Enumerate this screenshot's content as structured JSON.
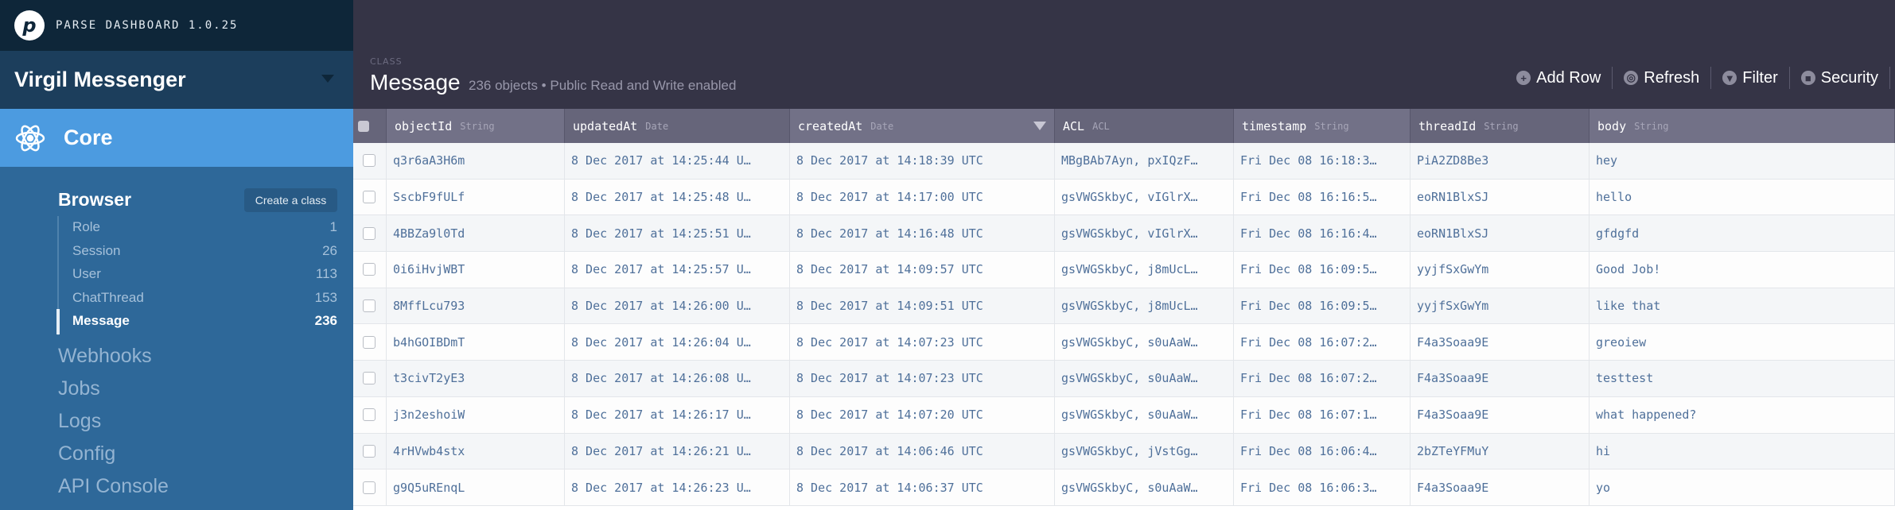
{
  "brand": {
    "title": "PARSE DASHBOARD 1.0.25"
  },
  "app": {
    "name": "Virgil Messenger"
  },
  "sidebar": {
    "section": "Core",
    "browser": {
      "label": "Browser",
      "create_label": "Create a class",
      "classes": [
        {
          "name": "Role",
          "count": "1"
        },
        {
          "name": "Session",
          "count": "26"
        },
        {
          "name": "User",
          "count": "113"
        },
        {
          "name": "ChatThread",
          "count": "153"
        },
        {
          "name": "Message",
          "count": "236",
          "active": true
        }
      ]
    },
    "nav": [
      "Webhooks",
      "Jobs",
      "Logs",
      "Config",
      "API Console"
    ]
  },
  "header": {
    "class_label": "CLASS",
    "class_name": "Message",
    "subtitle": "236 objects • Public Read and Write enabled",
    "toolbar": [
      {
        "label": "Add Row",
        "icon": "plus-circle-icon"
      },
      {
        "label": "Refresh",
        "icon": "refresh-icon"
      },
      {
        "label": "Filter",
        "icon": "filter-icon"
      },
      {
        "label": "Security",
        "icon": "lock-icon"
      }
    ]
  },
  "table": {
    "sorted_column": "createdAt",
    "sort_direction": "descending",
    "columns": [
      {
        "name": "objectId",
        "type": "String"
      },
      {
        "name": "updatedAt",
        "type": "Date"
      },
      {
        "name": "createdAt",
        "type": "Date"
      },
      {
        "name": "ACL",
        "type": "ACL"
      },
      {
        "name": "timestamp",
        "type": "String"
      },
      {
        "name": "threadId",
        "type": "String"
      },
      {
        "name": "body",
        "type": "String"
      }
    ],
    "rows": [
      [
        "q3r6aA3H6m",
        "8 Dec 2017 at 14:25:44 U…",
        "8 Dec 2017 at 14:18:39 UTC",
        "MBgBAb7Ayn, pxIQzF…",
        "Fri Dec 08 16:18:3…",
        "PiA2ZD8Be3",
        "hey"
      ],
      [
        "SscbF9fULf",
        "8 Dec 2017 at 14:25:48 U…",
        "8 Dec 2017 at 14:17:00 UTC",
        "gsVWGSkbyC, vIGlrX…",
        "Fri Dec 08 16:16:5…",
        "eoRN1BlxSJ",
        "hello"
      ],
      [
        "4BBZa9l0Td",
        "8 Dec 2017 at 14:25:51 U…",
        "8 Dec 2017 at 14:16:48 UTC",
        "gsVWGSkbyC, vIGlrX…",
        "Fri Dec 08 16:16:4…",
        "eoRN1BlxSJ",
        "gfdgfd"
      ],
      [
        "0i6iHvjWBT",
        "8 Dec 2017 at 14:25:57 U…",
        "8 Dec 2017 at 14:09:57 UTC",
        "gsVWGSkbyC, j8mUcL…",
        "Fri Dec 08 16:09:5…",
        "yyjfSxGwYm",
        "Good Job!"
      ],
      [
        "8MffLcu793",
        "8 Dec 2017 at 14:26:00 U…",
        "8 Dec 2017 at 14:09:51 UTC",
        "gsVWGSkbyC, j8mUcL…",
        "Fri Dec 08 16:09:5…",
        "yyjfSxGwYm",
        "like that"
      ],
      [
        "b4hGOIBDmT",
        "8 Dec 2017 at 14:26:04 U…",
        "8 Dec 2017 at 14:07:23 UTC",
        "gsVWGSkbyC, s0uAaW…",
        "Fri Dec 08 16:07:2…",
        "F4a3Soaa9E",
        "greoiew"
      ],
      [
        "t3civT2yE3",
        "8 Dec 2017 at 14:26:08 U…",
        "8 Dec 2017 at 14:07:23 UTC",
        "gsVWGSkbyC, s0uAaW…",
        "Fri Dec 08 16:07:2…",
        "F4a3Soaa9E",
        "testtest"
      ],
      [
        "j3n2eshoiW",
        "8 Dec 2017 at 14:26:17 U…",
        "8 Dec 2017 at 14:07:20 UTC",
        "gsVWGSkbyC, s0uAaW…",
        "Fri Dec 08 16:07:1…",
        "F4a3Soaa9E",
        "what happened?"
      ],
      [
        "4rHVwb4stx",
        "8 Dec 2017 at 14:26:21 U…",
        "8 Dec 2017 at 14:06:46 UTC",
        "gsVWGSkbyC, jVstGg…",
        "Fri Dec 08 16:06:4…",
        "2bZTeYFMuY",
        "hi"
      ],
      [
        "g9Q5uREnqL",
        "8 Dec 2017 at 14:26:23 U…",
        "8 Dec 2017 at 14:06:37 UTC",
        "gsVWGSkbyC, s0uAaW…",
        "Fri Dec 08 16:06:3…",
        "F4a3Soaa9E",
        "yo"
      ]
    ]
  }
}
